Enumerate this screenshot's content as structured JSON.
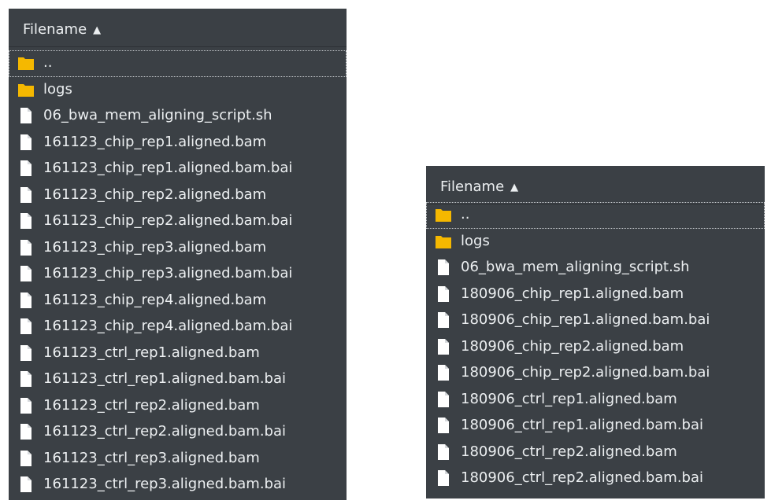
{
  "left": {
    "header": {
      "label": "Filename",
      "sort_icon": "chevron-up-icon"
    },
    "items": [
      {
        "name": "..",
        "type": "folder"
      },
      {
        "name": "logs",
        "type": "folder"
      },
      {
        "name": "06_bwa_mem_aligning_script.sh",
        "type": "file"
      },
      {
        "name": "161123_chip_rep1.aligned.bam",
        "type": "file"
      },
      {
        "name": "161123_chip_rep1.aligned.bam.bai",
        "type": "file"
      },
      {
        "name": "161123_chip_rep2.aligned.bam",
        "type": "file"
      },
      {
        "name": "161123_chip_rep2.aligned.bam.bai",
        "type": "file"
      },
      {
        "name": "161123_chip_rep3.aligned.bam",
        "type": "file"
      },
      {
        "name": "161123_chip_rep3.aligned.bam.bai",
        "type": "file"
      },
      {
        "name": "161123_chip_rep4.aligned.bam",
        "type": "file"
      },
      {
        "name": "161123_chip_rep4.aligned.bam.bai",
        "type": "file"
      },
      {
        "name": "161123_ctrl_rep1.aligned.bam",
        "type": "file"
      },
      {
        "name": "161123_ctrl_rep1.aligned.bam.bai",
        "type": "file"
      },
      {
        "name": "161123_ctrl_rep2.aligned.bam",
        "type": "file"
      },
      {
        "name": "161123_ctrl_rep2.aligned.bam.bai",
        "type": "file"
      },
      {
        "name": "161123_ctrl_rep3.aligned.bam",
        "type": "file"
      },
      {
        "name": "161123_ctrl_rep3.aligned.bam.bai",
        "type": "file"
      }
    ]
  },
  "right": {
    "header": {
      "label": "Filename",
      "sort_icon": "chevron-up-icon"
    },
    "items": [
      {
        "name": "..",
        "type": "folder"
      },
      {
        "name": "logs",
        "type": "folder"
      },
      {
        "name": "06_bwa_mem_aligning_script.sh",
        "type": "file"
      },
      {
        "name": "180906_chip_rep1.aligned.bam",
        "type": "file"
      },
      {
        "name": "180906_chip_rep1.aligned.bam.bai",
        "type": "file"
      },
      {
        "name": "180906_chip_rep2.aligned.bam",
        "type": "file"
      },
      {
        "name": "180906_chip_rep2.aligned.bam.bai",
        "type": "file"
      },
      {
        "name": "180906_ctrl_rep1.aligned.bam",
        "type": "file"
      },
      {
        "name": "180906_ctrl_rep1.aligned.bam.bai",
        "type": "file"
      },
      {
        "name": "180906_ctrl_rep2.aligned.bam",
        "type": "file"
      },
      {
        "name": "180906_ctrl_rep2.aligned.bam.bai",
        "type": "file"
      }
    ]
  },
  "colors": {
    "panel_bg": "#3b4045",
    "folder": "#f5b800",
    "file": "#ffffff",
    "text": "#eceff1"
  }
}
